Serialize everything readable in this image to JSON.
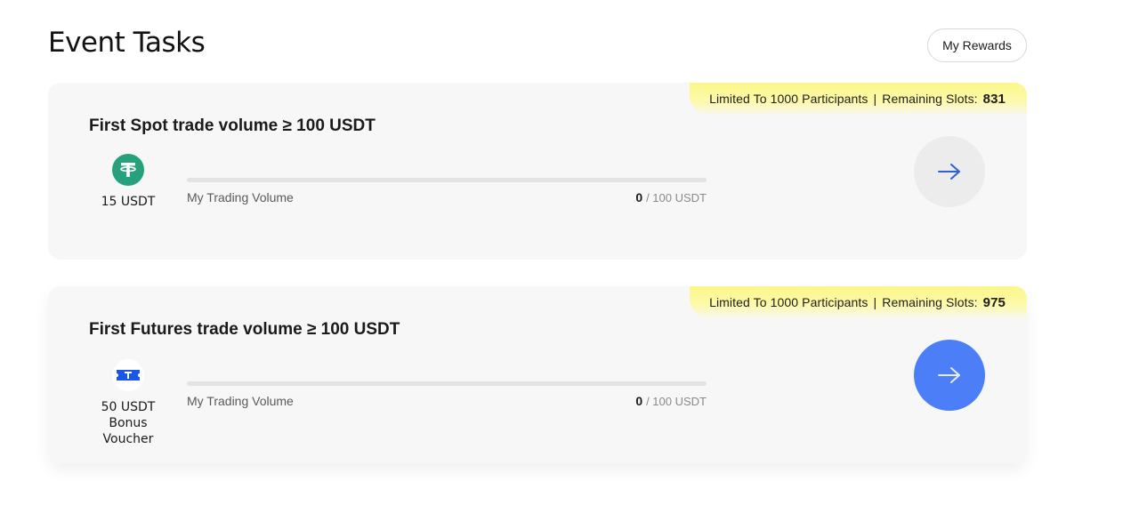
{
  "header": {
    "title": "Event Tasks",
    "rewards_label": "My Rewards"
  },
  "tasks": [
    {
      "title": "First Spot trade volume ≥ 100 USDT",
      "slots": {
        "text": "Limited To 1000 Participants",
        "separator": "|",
        "remaining_label": "Remaining Slots:",
        "remaining": "831"
      },
      "reward": {
        "icon": "tether-icon",
        "lines": [
          "15 USDT"
        ]
      },
      "progress": {
        "label": "My Trading Volume",
        "current": "0",
        "total": "/ 100 USDT",
        "fraction": 0
      },
      "action": {
        "icon": "arrow-right-icon",
        "state": "inactive"
      }
    },
    {
      "title": "First Futures trade volume ≥ 100 USDT",
      "slots": {
        "text": "Limited To 1000 Participants",
        "separator": "|",
        "remaining_label": "Remaining Slots:",
        "remaining": "975"
      },
      "reward": {
        "icon": "voucher-ticket-icon",
        "lines": [
          "50 USDT",
          "Bonus",
          "Voucher"
        ]
      },
      "progress": {
        "label": "My Trading Volume",
        "current": "0",
        "total": "/ 100 USDT",
        "fraction": 0
      },
      "action": {
        "icon": "arrow-right-icon",
        "state": "active"
      }
    }
  ],
  "colors": {
    "accent": "#4b7ef7",
    "tether": "#26a17b",
    "banner": "#fbf78a",
    "card": "#f7f7f7"
  }
}
